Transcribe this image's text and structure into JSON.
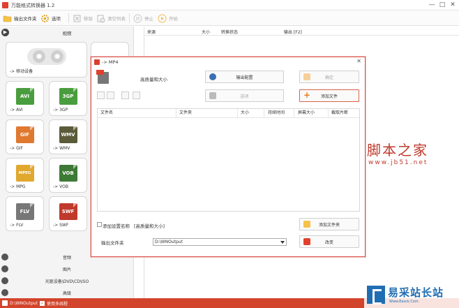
{
  "window": {
    "title": "万能格式转换器 1.2"
  },
  "toolbar": {
    "output_folder": "输出文件夹",
    "options": "选项",
    "remove": "移除",
    "clear_list": "清空列表",
    "stop": "停止",
    "start": "开始"
  },
  "sidebar": {
    "video_header": "视频",
    "mobile_label": "-> 移动设备",
    "tiles": [
      {
        "badge": "AVI",
        "label": "-> AVI",
        "color": "#4a9d3e"
      },
      {
        "badge": "3GP",
        "label": "-> 3GP",
        "color": "#4a9d3e"
      },
      {
        "badge": "GIF",
        "label": "-> GIF",
        "color": "#e0782f"
      },
      {
        "badge": "WMV",
        "label": "-> WMV",
        "color": "#5b5b3a"
      },
      {
        "badge": "MPEG",
        "label": "-> MPG",
        "color": "#e0a82f"
      },
      {
        "badge": "VOB",
        "label": "-> VOB",
        "color": "#3d7a35"
      },
      {
        "badge": "FLV",
        "label": "-> FLV",
        "color": "#777777"
      },
      {
        "badge": "SWF",
        "label": "-> SWF",
        "color": "#c0392b"
      }
    ],
    "audio": "音频",
    "picture": "图片",
    "optical": "光驱设备\\DVD\\CD\\ISO",
    "advanced": "高级"
  },
  "filelist": {
    "headers": [
      "来源",
      "大小",
      "转换状态",
      "输出 [F2]"
    ]
  },
  "statusbar": {
    "path": "D:\\WNOutput",
    "multithread": "使用多线程"
  },
  "dialog": {
    "title": "-> MP4",
    "quality": "高质量和大小",
    "output_config": "输出配置",
    "ok": "确定",
    "options": "选项",
    "add_file": "添加文件",
    "columns": [
      "文件名",
      "文件夹",
      "大小",
      "持续时间",
      "屏幕大小",
      "截取片断"
    ],
    "add_setting_name": "添加设置名称",
    "setting_value": "[高质量和大小]",
    "add_folder": "添加文件夹",
    "output_folder_label": "输出文件夹",
    "output_folder_value": "D:\\WNOutput",
    "change": "改变"
  },
  "watermarks": {
    "jb51_cn": "脚本之家",
    "jb51_url": "www.jb51.net",
    "yicai_cn": "易采站长站",
    "yicai_url": "Www.Easck.Com"
  }
}
